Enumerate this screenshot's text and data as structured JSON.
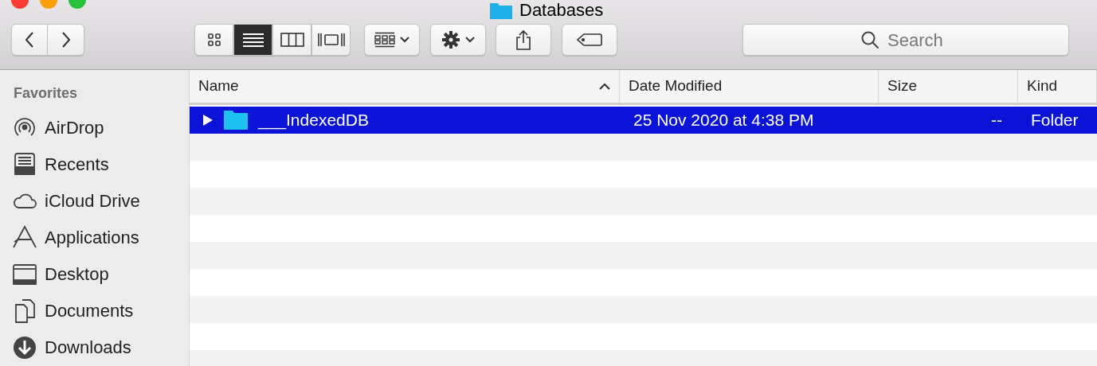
{
  "window": {
    "title": "Databases"
  },
  "view_modes": [
    {
      "kind": "icons",
      "selected": false
    },
    {
      "kind": "list",
      "selected": true
    },
    {
      "kind": "columns",
      "selected": false
    },
    {
      "kind": "gallery",
      "selected": false
    }
  ],
  "search": {
    "placeholder": "Search"
  },
  "sidebar": {
    "heading": "Favorites",
    "items": [
      {
        "kind": "airdrop",
        "label": "AirDrop"
      },
      {
        "kind": "recents",
        "label": "Recents"
      },
      {
        "kind": "icloud",
        "label": "iCloud Drive"
      },
      {
        "kind": "applications",
        "label": "Applications"
      },
      {
        "kind": "desktop",
        "label": "Desktop"
      },
      {
        "kind": "documents",
        "label": "Documents"
      },
      {
        "kind": "downloads",
        "label": "Downloads"
      }
    ]
  },
  "table": {
    "columns": [
      "Name",
      "Date Modified",
      "Size",
      "Kind"
    ],
    "rows": [
      {
        "name": "___IndexedDB",
        "date": "25 Nov 2020 at 4:38 PM",
        "size": "--",
        "kind": "Folder",
        "selected": true,
        "expanded": false
      }
    ]
  }
}
